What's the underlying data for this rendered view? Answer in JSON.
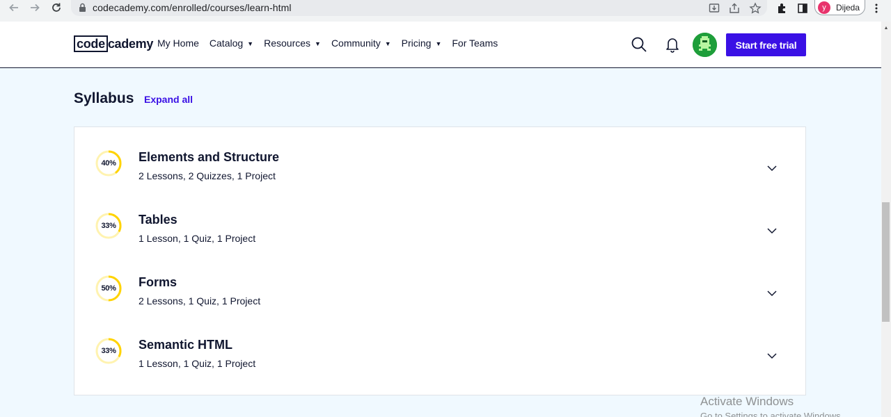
{
  "browser": {
    "url": "codecademy.com/enrolled/courses/learn-html",
    "profile_initial": "y",
    "profile_name": "Dijeda"
  },
  "header": {
    "logo_box": "code",
    "logo_rest": "cademy",
    "nav": [
      {
        "label": "My Home",
        "has_caret": false
      },
      {
        "label": "Catalog",
        "has_caret": true
      },
      {
        "label": "Resources",
        "has_caret": true
      },
      {
        "label": "Community",
        "has_caret": true
      },
      {
        "label": "Pricing",
        "has_caret": true
      },
      {
        "label": "For Teams",
        "has_caret": false
      }
    ],
    "cta_label": "Start free trial",
    "caret": "▼"
  },
  "syllabus": {
    "title": "Syllabus",
    "expand_label": "Expand all",
    "modules": [
      {
        "progress_label": "40%",
        "progress": 0.4,
        "title": "Elements and Structure",
        "summary": "2 Lessons, 2 Quizzes, 1 Project"
      },
      {
        "progress_label": "33%",
        "progress": 0.33,
        "title": "Tables",
        "summary": "1 Lesson, 1 Quiz, 1 Project"
      },
      {
        "progress_label": "50%",
        "progress": 0.5,
        "title": "Forms",
        "summary": "2 Lessons, 1 Quiz, 1 Project"
      },
      {
        "progress_label": "33%",
        "progress": 0.33,
        "title": "Semantic HTML",
        "summary": "1 Lesson, 1 Quiz, 1 Project"
      }
    ]
  },
  "watermark": {
    "title": "Activate Windows",
    "subtitle": "Go to Settings to activate Windows."
  },
  "colors": {
    "accent": "#3a10e5",
    "ring_fill": "#ffd300",
    "ring_track": "#fff3b0",
    "page_bg": "#f0f9ff"
  },
  "icons": [
    "back-arrow-icon",
    "forward-arrow-icon",
    "reload-icon",
    "lock-icon",
    "install-icon",
    "share-icon",
    "star-icon",
    "extensions-icon",
    "side-panel-icon",
    "kebab-menu-icon",
    "search-icon",
    "bell-icon",
    "chevron-down-icon"
  ]
}
